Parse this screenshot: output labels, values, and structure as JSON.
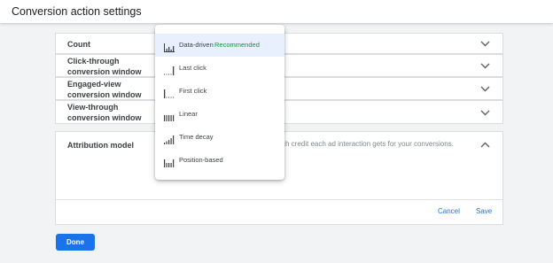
{
  "header": {
    "title": "Conversion action settings"
  },
  "settings": {
    "rows": [
      {
        "label": "Count"
      },
      {
        "label": "Click-through conversion window"
      },
      {
        "label": "Engaged-view conversion window"
      },
      {
        "label": "View-through conversion window"
      }
    ],
    "attribution": {
      "label": "Attribution model",
      "description": "ch credit each ad interaction gets for your conversions.",
      "cancel": "Cancel",
      "save": "Save"
    }
  },
  "footer": {
    "done": "Done"
  },
  "dropdown": {
    "selected_index": 0,
    "items": [
      {
        "label": "Data-driven",
        "badge": "Recommended",
        "icon": "data-driven-icon"
      },
      {
        "label": "Last click",
        "icon": "last-click-icon"
      },
      {
        "label": "First click",
        "icon": "first-click-icon"
      },
      {
        "label": "Linear",
        "icon": "linear-icon"
      },
      {
        "label": "Time decay",
        "icon": "time-decay-icon"
      },
      {
        "label": "Position-based",
        "icon": "position-based-icon"
      }
    ]
  },
  "colors": {
    "accent": "#1a73e8",
    "recommended": "#1e8e3e",
    "selected_bg": "#e8f0fe"
  }
}
